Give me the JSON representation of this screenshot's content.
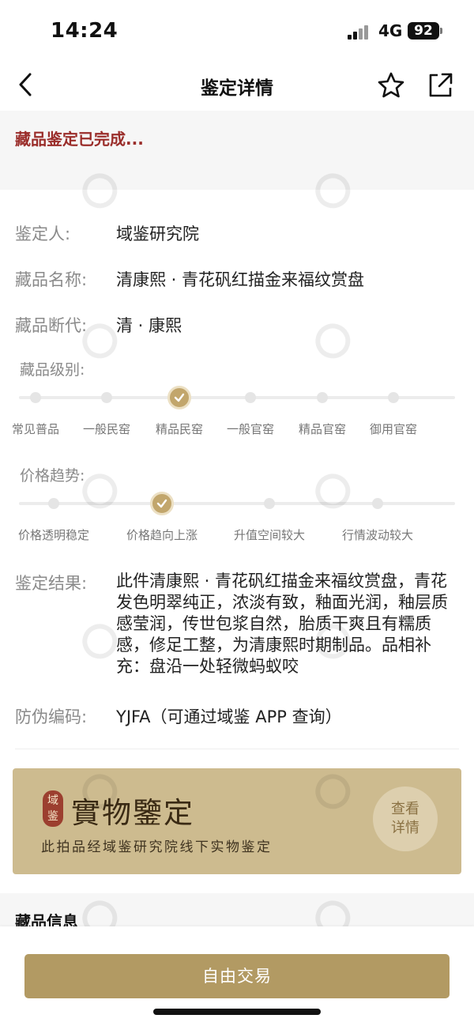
{
  "status_bar": {
    "time": "14:24",
    "network": "4G",
    "battery": "92"
  },
  "nav": {
    "title": "鉴定详情",
    "back_icon": "chevron-left-icon",
    "star_icon": "star-outline-icon",
    "share_icon": "share-icon"
  },
  "notice": "藏品鉴定已完成...",
  "details": {
    "appraiser_label": "鉴定人:",
    "appraiser_value": "域鉴研究院",
    "name_label": "藏品名称:",
    "name_value": "清康熙 · 青花矾红描金来福纹赏盘",
    "dating_label": "藏品断代:",
    "dating_value": "清 · 康熙"
  },
  "level": {
    "title": "藏品级别:",
    "options": [
      "常见普品",
      "一般民窑",
      "精品民窑",
      "一般官窑",
      "精品官窑",
      "御用官窑"
    ],
    "selected_index": 2
  },
  "price": {
    "title": "价格趋势:",
    "options": [
      "价格透明稳定",
      "价格趋向上涨",
      "升值空间较大",
      "行情波动较大"
    ],
    "selected_index": 1
  },
  "result": {
    "label": "鉴定结果:",
    "text": "此件清康熙 · 青花矾红描金来福纹赏盘，青花发色明翠纯正，浓淡有致，釉面光润，釉层质感莹润，传世包浆自然，胎质干爽且有糯质感，修足工整，为清康熙时期制品。品相补充：盘沿一处轻微蚂蚁咬"
  },
  "anti_fake": {
    "label": "防伪编码:",
    "value": "YJFA（可通过域鉴 APP 查询）"
  },
  "banner": {
    "seal_top": "域",
    "seal_bottom": "鉴",
    "title": "實物鑒定",
    "subtitle": "此拍品经域鉴研究院线下实物鉴定",
    "button_line1": "查看",
    "button_line2": "详情"
  },
  "section_title": "藏品信息",
  "bottom_button": "自由交易",
  "colors": {
    "accent": "#b29a63",
    "notice": "#9a2d2a",
    "banner_bg": "#cdbb8f",
    "selected_dot": "#c2a66c"
  }
}
